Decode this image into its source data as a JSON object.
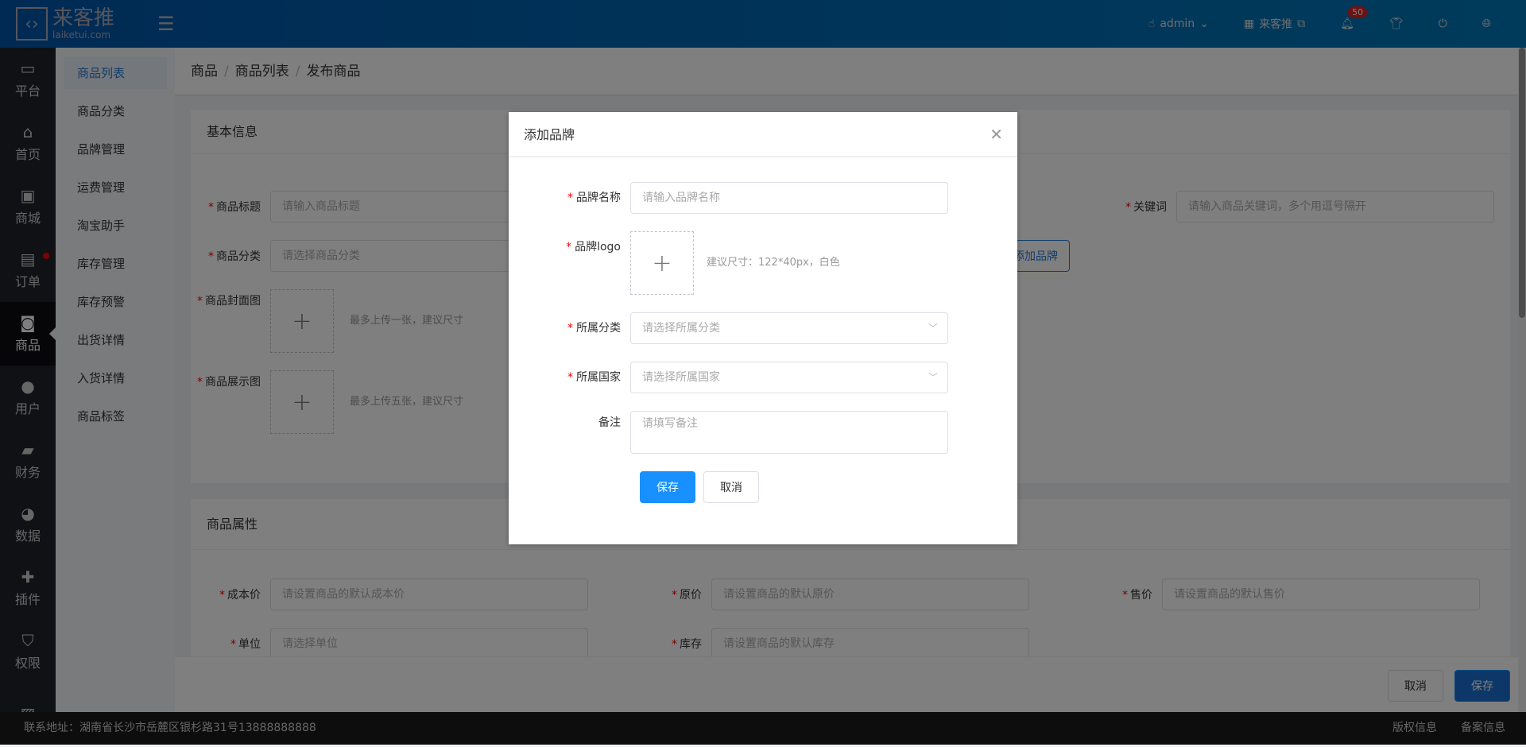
{
  "header": {
    "logo_cn": "来客推",
    "logo_en": "laiketui.com",
    "user": "admin",
    "store": "来客推",
    "notifications": "50",
    "icons": [
      "menu-fold-icon",
      "hand-icon",
      "store-icon",
      "external-link-icon",
      "bell-icon",
      "shirt-icon",
      "power-icon",
      "globe-icon"
    ]
  },
  "sidebar": {
    "items": [
      {
        "label": "平台",
        "icon": "platform-icon"
      },
      {
        "label": "首页",
        "icon": "home-icon"
      },
      {
        "label": "商城",
        "icon": "mall-icon"
      },
      {
        "label": "订单",
        "icon": "order-icon",
        "dot": true
      },
      {
        "label": "商品",
        "icon": "bag-icon",
        "active": true
      },
      {
        "label": "用户",
        "icon": "user-icon"
      },
      {
        "label": "财务",
        "icon": "wallet-icon"
      },
      {
        "label": "数据",
        "icon": "pie-icon"
      },
      {
        "label": "插件",
        "icon": "puzzle-icon"
      },
      {
        "label": "权限",
        "icon": "shield-icon"
      },
      {
        "label": "",
        "icon": "image-icon"
      }
    ]
  },
  "submenu": {
    "items": [
      "商品列表",
      "商品分类",
      "品牌管理",
      "运费管理",
      "淘宝助手",
      "库存管理",
      "库存预警",
      "出货详情",
      "入货详情",
      "商品标签"
    ]
  },
  "breadcrumb": [
    "商品",
    "商品列表",
    "发布商品"
  ],
  "basic": {
    "title": "基本信息",
    "product_title": {
      "label": "商品标题",
      "placeholder": "请输入商品标题"
    },
    "keywords": {
      "label": "关键词",
      "placeholder": "请输入商品关键词，多个用逗号隔开"
    },
    "category": {
      "label": "商品分类",
      "placeholder": "请选择商品分类"
    },
    "add_brand": "添加品牌",
    "cover": {
      "label": "商品封面图",
      "hint": "最多上传一张，建议尺寸"
    },
    "gallery": {
      "label": "商品展示图",
      "hint": "最多上传五张，建议尺寸"
    }
  },
  "attrs": {
    "title": "商品属性",
    "cost": {
      "label": "成本价",
      "placeholder": "请设置商品的默认成本价"
    },
    "original": {
      "label": "原价",
      "placeholder": "请设置商品的默认原价"
    },
    "price": {
      "label": "售价",
      "placeholder": "请设置商品的默认售价"
    },
    "unit": {
      "label": "单位",
      "placeholder": "请选择单位"
    },
    "stock": {
      "label": "库存",
      "placeholder": "请设置商品的默认库存"
    }
  },
  "actions": {
    "cancel": "取消",
    "save": "保存"
  },
  "footer": {
    "address": "联系地址：湖南省长沙市岳麓区银杉路31号13888888888",
    "copyright": "版权信息",
    "icp": "备案信息"
  },
  "modal": {
    "title": "添加品牌",
    "name": {
      "label": "品牌名称",
      "placeholder": "请输入品牌名称"
    },
    "logo": {
      "label": "品牌logo",
      "hint": "建议尺寸：122*40px，白色"
    },
    "category": {
      "label": "所属分类",
      "placeholder": "请选择所属分类"
    },
    "country": {
      "label": "所属国家",
      "placeholder": "请选择所属国家"
    },
    "remark": {
      "label": "备注",
      "placeholder": "请填写备注"
    },
    "save": "保存",
    "cancel": "取消"
  },
  "colors": {
    "primary": "#1890ff",
    "header": "#0055a8",
    "sidebar": "#1f2229",
    "required": "#ff0000"
  }
}
